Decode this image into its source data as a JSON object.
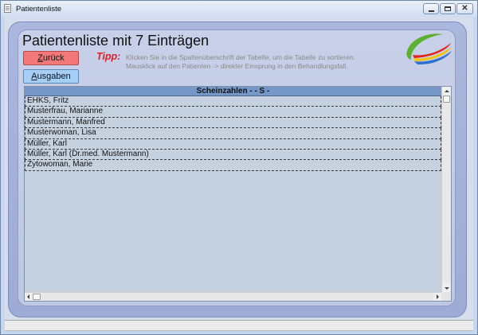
{
  "window": {
    "title": "Patientenliste",
    "icon": "app-icon",
    "controls": {
      "minimize_icon": "minimize-icon",
      "maximize_icon": "maximize-icon",
      "close_icon": "close-icon"
    }
  },
  "page": {
    "title": "Patientenliste mit 7 Einträgen"
  },
  "actions": {
    "back_label": "Zurück",
    "outputs_label": "Ausgaben"
  },
  "tip": {
    "label": "Tipp:",
    "line1": "Klicken Sie in die Spaltenüberschrift der Tabelle, um die Tabelle zu sortieren.",
    "line2": "Mausklick auf den Patienten -> direkter Einsprung in den Behandlungsfall."
  },
  "table": {
    "column_header": "Scheinzahlen - - S -",
    "rows": [
      "EHKS, Fritz",
      "Musterfrau, Marianne",
      "Mustermann, Manfred",
      "Musterwoman, Lisa",
      "Müller, Karl",
      "Müller, Karl (Dr.med. Mustermann)",
      "Zytowoman, Marie"
    ],
    "scrollbar_icons": {
      "up": "scroll-up-icon",
      "down": "scroll-down-icon",
      "left": "scroll-left-icon",
      "right": "scroll-right-icon"
    }
  },
  "logo": "company-logo",
  "colors": {
    "back_button": "#f47878",
    "outputs_button": "#a6cff7",
    "tip_label": "#e41e26",
    "table_header": "#7598c9",
    "table_body": "#c6d1e0",
    "logo_green": "#5db12f",
    "logo_red": "#e2231a",
    "logo_yellow": "#f3c300",
    "logo_blue": "#2f6fd0"
  }
}
